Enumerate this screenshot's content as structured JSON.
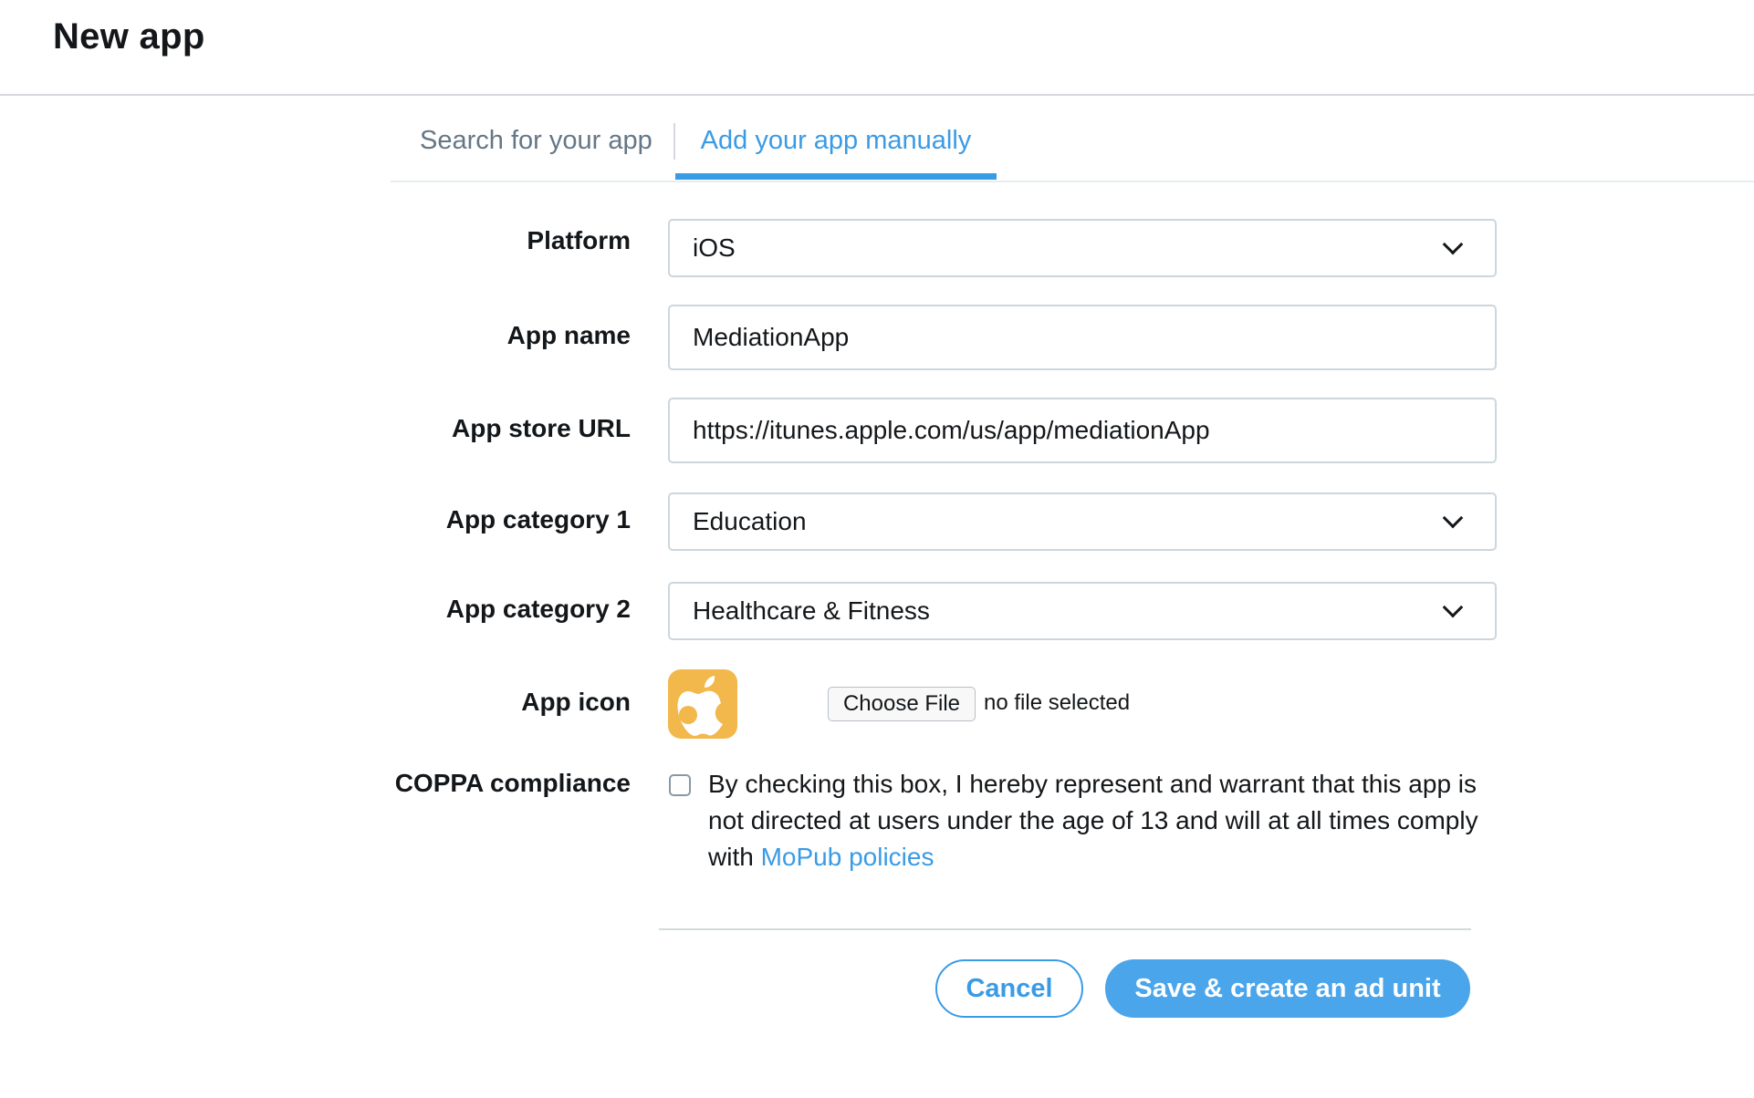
{
  "header": {
    "title": "New app"
  },
  "tabs": [
    {
      "label": "Search for your app",
      "active": false
    },
    {
      "label": "Add your app manually",
      "active": true
    }
  ],
  "form": {
    "platform": {
      "label": "Platform",
      "value": "iOS"
    },
    "app_name": {
      "label": "App name",
      "value": "MediationApp"
    },
    "app_store_url": {
      "label": "App store URL",
      "value": "https://itunes.apple.com/us/app/mediationApp"
    },
    "category_1": {
      "label": "App category 1",
      "value": "Education"
    },
    "category_2": {
      "label": "App category 2",
      "value": "Healthcare & Fitness"
    },
    "app_icon": {
      "label": "App icon",
      "icon": "apple-logo-icon",
      "choose_file_label": "Choose File",
      "file_status": "no file selected"
    },
    "coppa": {
      "label": "COPPA compliance",
      "checked": false,
      "text": "By checking this box, I hereby represent and warrant that this app is not directed at users under the age of 13 and will at all times comply with ",
      "link_text": "MoPub policies"
    }
  },
  "actions": {
    "cancel_label": "Cancel",
    "save_label": "Save & create an ad unit"
  },
  "colors": {
    "accent": "#3a9be5",
    "app_icon_bg": "#f2b84b"
  }
}
